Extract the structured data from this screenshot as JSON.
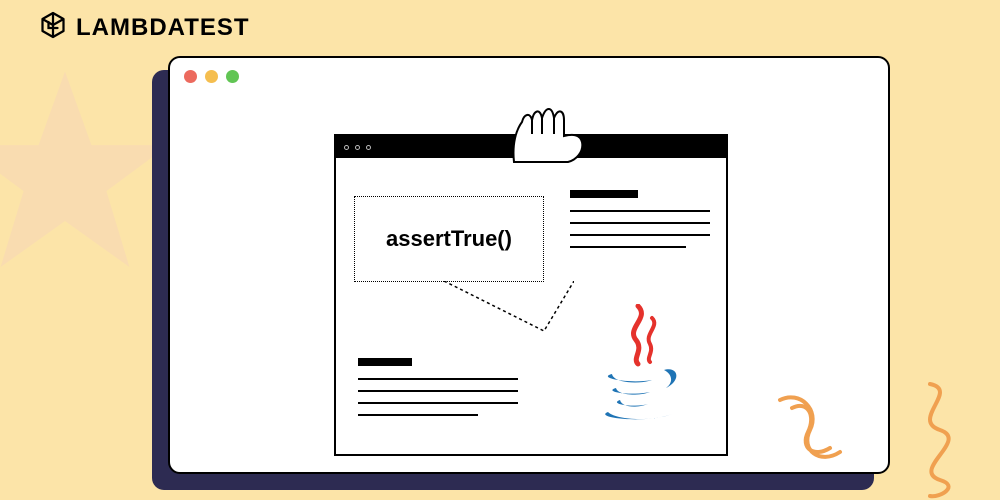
{
  "brand": {
    "name": "LAMBDATEST"
  },
  "callout": {
    "text": "assertTrue()"
  },
  "icons": {
    "logo": "lambdatest-logo-icon",
    "star": "star-icon",
    "hand": "grabbing-hand-icon",
    "java": "java-logo-icon",
    "squiggle": "squiggle-icon"
  },
  "colors": {
    "background": "#fce4a8",
    "shadow": "#2d2b52",
    "accent_orange": "#f0a050",
    "java_red": "#e5322c",
    "java_blue": "#1f74b5"
  }
}
